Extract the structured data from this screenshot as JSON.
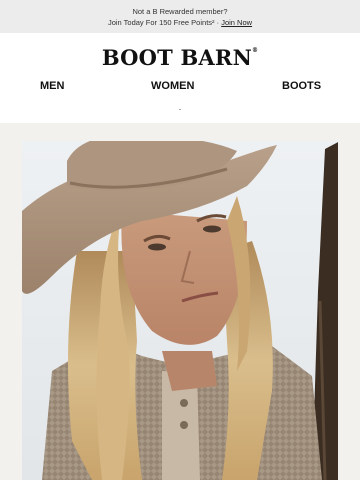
{
  "promo": {
    "line1": "Not a B Rewarded member?",
    "line2_text": "Join Today For 150 Free Points",
    "line2_marks": "² · ",
    "join_link": "Join Now"
  },
  "brand": {
    "name": "BOOT BARN",
    "mark": "®"
  },
  "nav": {
    "men": "MEN",
    "women": "WOMEN",
    "boots": "BOOTS"
  },
  "hero": {
    "subject": "woman-in-cowboy-hat-photo"
  }
}
